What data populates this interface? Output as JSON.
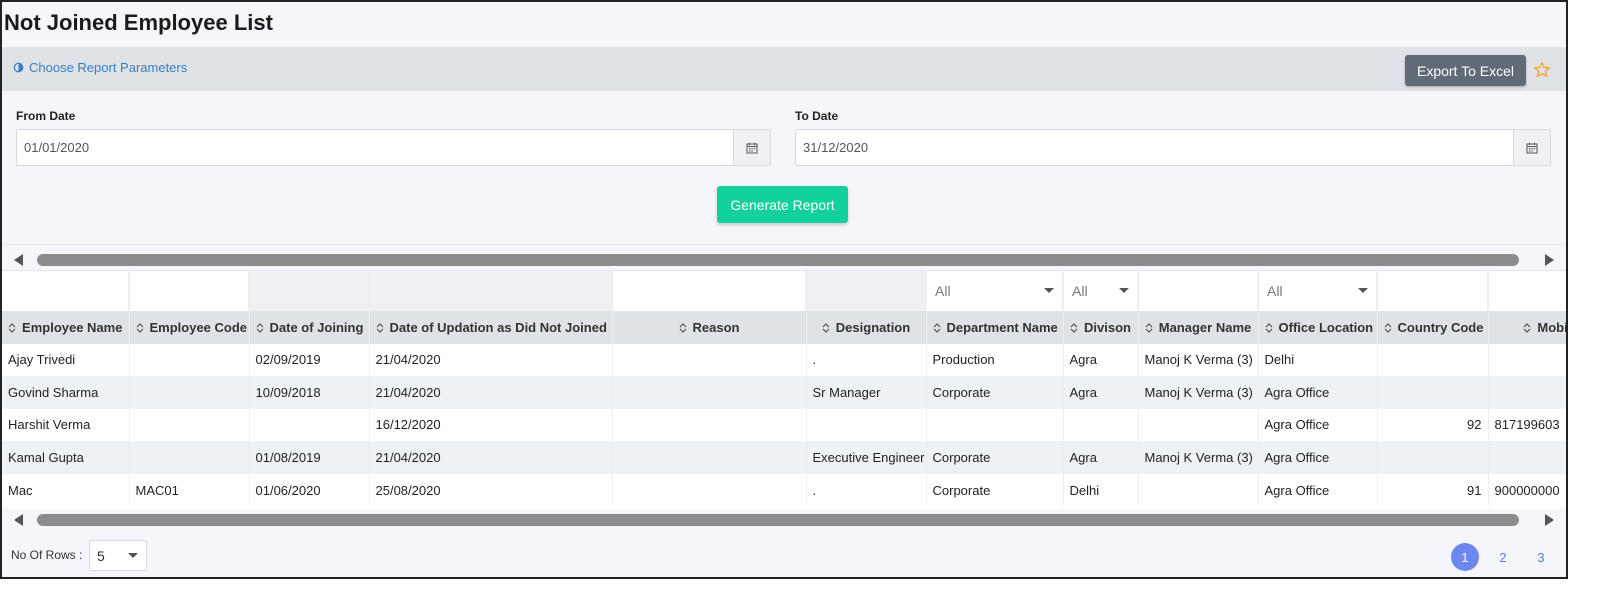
{
  "page": {
    "title": "Not Joined Employee List"
  },
  "params": {
    "link_label": "Choose Report Parameters",
    "export_label": "Export To Excel",
    "from_label": "From Date",
    "from_value": "01/01/2020",
    "to_label": "To Date",
    "to_value": "31/12/2020",
    "generate_label": "Generate Report"
  },
  "grid": {
    "filters": {
      "department": "All",
      "division": "All",
      "office": "All"
    },
    "columns": [
      "Employee Name",
      "Employee Code",
      "Date of Joining",
      "Date of Updation as Did Not Joined",
      "Reason",
      "Designation",
      "Department Name",
      "Divison",
      "Manager Name",
      "Office Location",
      "Country Code",
      "Mobile"
    ],
    "rows": [
      [
        "Ajay Trivedi",
        "",
        "02/09/2019",
        "21/04/2020",
        "",
        ".",
        "Production",
        "Agra",
        "Manoj K Verma (3)",
        "Delhi",
        "",
        ""
      ],
      [
        "Govind Sharma",
        "",
        "10/09/2018",
        "21/04/2020",
        "",
        "Sr Manager",
        "Corporate",
        "Agra",
        "Manoj K Verma (3)",
        "Agra Office",
        "",
        ""
      ],
      [
        "Harshit Verma",
        "",
        "",
        "16/12/2020",
        "",
        "",
        "",
        "",
        "",
        "Agra Office",
        "92",
        "817199603"
      ],
      [
        "Kamal Gupta",
        "",
        "01/08/2019",
        "21/04/2020",
        "",
        "Executive Engineer",
        "Corporate",
        "Agra",
        "Manoj K Verma (3)",
        "Agra Office",
        "",
        ""
      ],
      [
        "Mac",
        "MAC01",
        "01/06/2020",
        "25/08/2020",
        "",
        ".",
        "Corporate",
        "Delhi",
        "",
        "Agra Office",
        "91",
        "900000000"
      ]
    ]
  },
  "footer": {
    "rows_label": "No Of Rows :",
    "rows_value": "5",
    "pages": [
      "1",
      "2",
      "3"
    ]
  },
  "colors": {
    "accent_green": "#12d19a",
    "export_gray": "#606b77",
    "pager_active": "#6e87f0",
    "star": "#f5a623"
  }
}
